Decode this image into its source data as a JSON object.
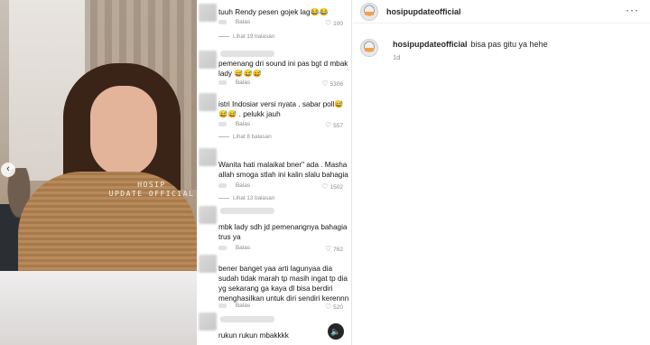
{
  "photo": {
    "watermark_line1": "HOSIP",
    "watermark_line2": "UPDATE OFFICIAL",
    "prev_icon": "‹"
  },
  "comments": [
    {
      "text": "tuuh Rendy pesen gojek lag😂😂",
      "reply_label": "Balas",
      "likes": "100",
      "replies_link": "Lihat 19 balasan"
    },
    {
      "text": "pemenang dri sound ini pas bgt d mbak lady 😅😅😅",
      "reply_label": "Balas",
      "likes": "5306",
      "replies_link": ""
    },
    {
      "text": "istri Indosiar versi nyata . sabar poll😅😅😅 . pelukk jauh",
      "reply_label": "Balas",
      "likes": "557",
      "replies_link": "Lihat 8 balasan"
    },
    {
      "text": "Wanita hati malaikat bner\" ada . Masha allah smoga stlah ini kalin slalu bahagia",
      "reply_label": "Balas",
      "likes": "1502",
      "replies_link": "Lihat 13 balasan"
    },
    {
      "text": "mbk lady sdh jd pemenangnya bahagia trus ya",
      "reply_label": "Balas",
      "likes": "762",
      "replies_link": ""
    },
    {
      "text": "bener banget yaa arti lagunyaa dia sudah tidak marah tp masih ingat tp dia yg sekarang ga kaya dl bisa berdiri menghasilkan untuk diri sendiri kerennn",
      "reply_label": "Balas",
      "likes": "520",
      "replies_link": ""
    },
    {
      "text": "rukun rukun mbakkkk",
      "reply_label": "",
      "likes": "",
      "replies_link": ""
    }
  ],
  "sound_icon": "🔈",
  "post": {
    "username": "hosipupdateofficial",
    "more_icon": "···",
    "caption_user": "hosipupdateofficial",
    "caption_text": "bisa pas gitu ya hehe",
    "time": "1d"
  },
  "icons": {
    "heart": "♡"
  }
}
